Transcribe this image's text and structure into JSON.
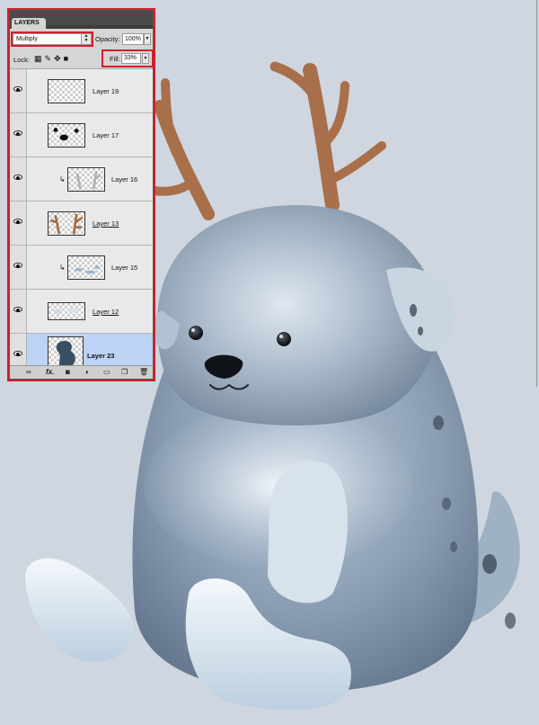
{
  "layers_panel": {
    "tab_label": "LAYERS",
    "blend_mode": "Multiply",
    "opacity_label": "Opacity:",
    "opacity_value": "100%",
    "lock_label": "Lock:",
    "fill_label": "Fill:",
    "fill_value": "33%",
    "layers": [
      {
        "name": "Layer 19",
        "visible": true,
        "clipped": false,
        "selected": false,
        "underlined": false,
        "thumb": "empty"
      },
      {
        "name": "Layer 17",
        "visible": true,
        "clipped": false,
        "selected": false,
        "underlined": false,
        "thumb": "face"
      },
      {
        "name": "Layer 16",
        "visible": true,
        "clipped": true,
        "selected": false,
        "underlined": false,
        "thumb": "antler-light"
      },
      {
        "name": "Layer 13",
        "visible": true,
        "clipped": false,
        "selected": false,
        "underlined": true,
        "thumb": "antlers"
      },
      {
        "name": "Layer 15",
        "visible": true,
        "clipped": true,
        "selected": false,
        "underlined": false,
        "thumb": "spots"
      },
      {
        "name": "Layer 12",
        "visible": true,
        "clipped": false,
        "selected": false,
        "underlined": true,
        "thumb": "light"
      },
      {
        "name": "Layer 23",
        "visible": true,
        "clipped": false,
        "selected": true,
        "underlined": false,
        "thumb": "figure"
      }
    ],
    "bottom_icons": [
      "link-icon",
      "fx-icon",
      "mask-icon",
      "adjustment-icon",
      "group-folder-icon",
      "new-layer-icon",
      "trash-icon"
    ]
  },
  "colors": {
    "canvas_bg": "#cfd6df",
    "antler": "#a86f4a",
    "fur_dark": "#7b8ea4",
    "fur_light": "#e6eef6",
    "paw": "#dfeaf4",
    "selection_highlight": "#bcd3f5",
    "callout_red": "#d0202a"
  }
}
